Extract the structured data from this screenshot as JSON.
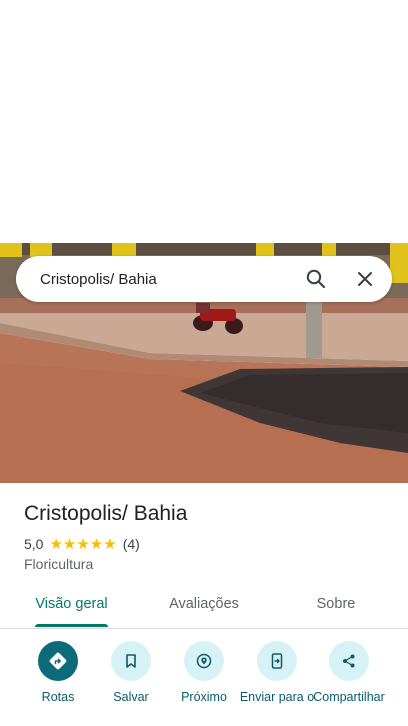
{
  "search": {
    "query": "Cristopolis/ Bahia"
  },
  "place": {
    "title": "Cristopolis/ Bahia",
    "rating": "5,0",
    "stars": "★★★★★",
    "review_count": "(4)",
    "category": "Floricultura"
  },
  "tabs": [
    {
      "label": "Visão geral",
      "active": true
    },
    {
      "label": "Avaliações",
      "active": false
    },
    {
      "label": "Sobre",
      "active": false
    }
  ],
  "actions": [
    {
      "label": "Rotas",
      "icon": "directions-icon"
    },
    {
      "label": "Salvar",
      "icon": "bookmark-icon"
    },
    {
      "label": "Próximo",
      "icon": "nearby-icon"
    },
    {
      "label": "Enviar para o",
      "icon": "send-to-phone-icon"
    },
    {
      "label": "Compartilhar",
      "icon": "share-icon"
    }
  ],
  "colors": {
    "accent": "#00796b",
    "primary_action": "#0b6b7a",
    "action_bg": "#d6f2f5",
    "star": "#fbbc04"
  }
}
